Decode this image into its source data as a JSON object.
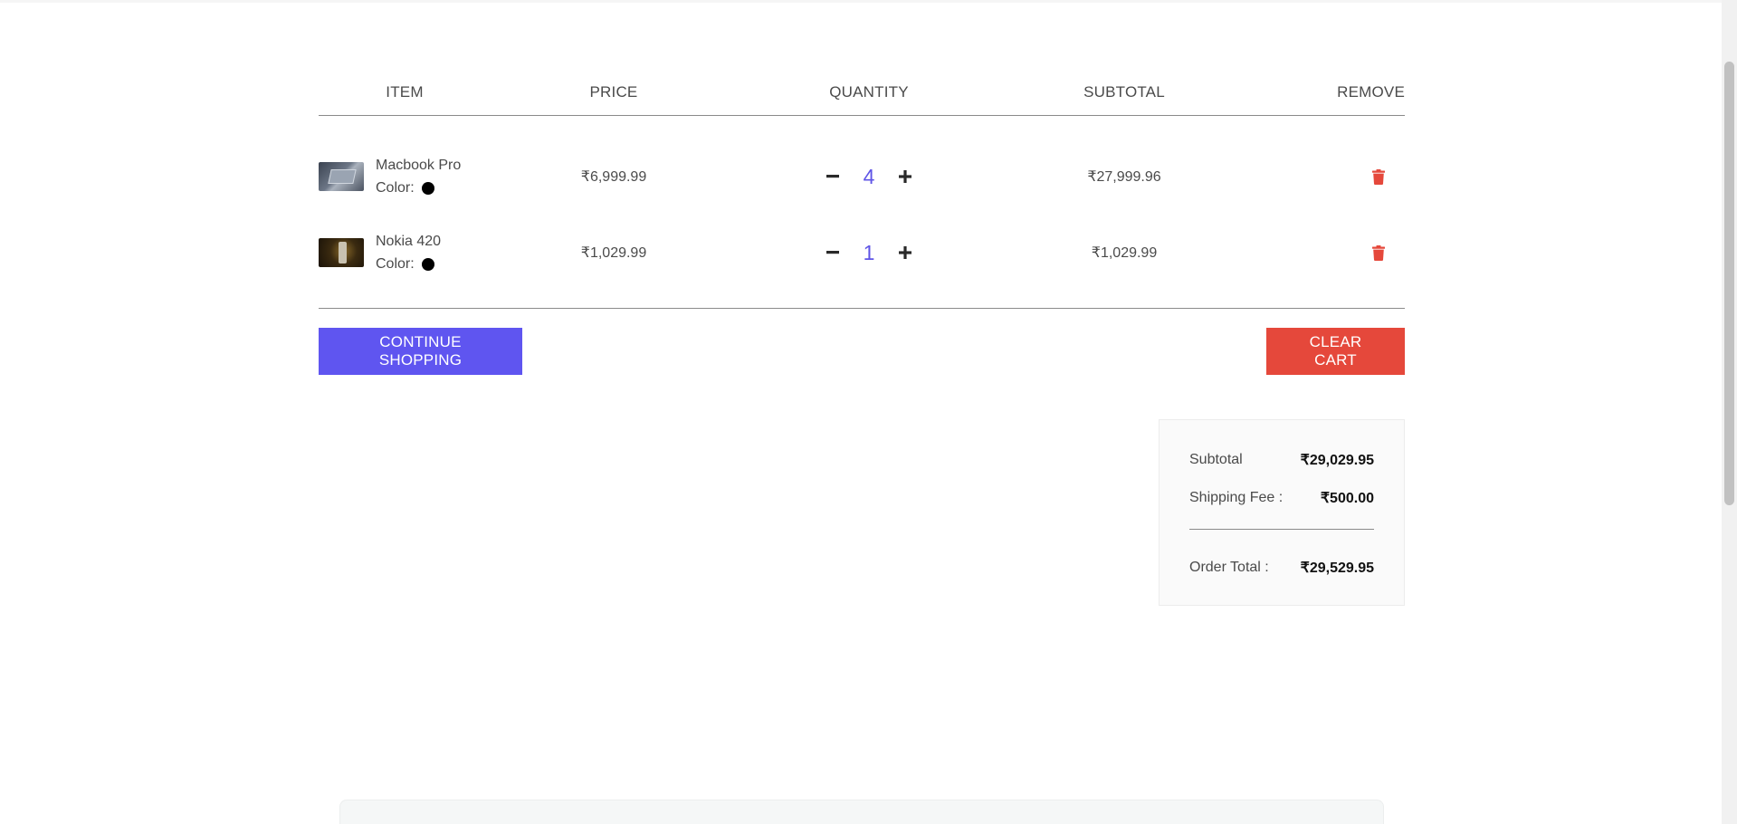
{
  "cart": {
    "headers": {
      "item": "ITEM",
      "price": "PRICE",
      "quantity": "QUANTITY",
      "subtotal": "SUBTOTAL",
      "remove": "REMOVE"
    },
    "color_label": "Color:",
    "items": [
      {
        "name": "Macbook Pro",
        "color": "#000000",
        "price": "₹6,999.99",
        "quantity": "4",
        "subtotal": "₹27,999.96",
        "image": "macbook-image"
      },
      {
        "name": "Nokia 420",
        "color": "#000000",
        "price": "₹1,029.99",
        "quantity": "1",
        "subtotal": "₹1,029.99",
        "image": "nokia-image"
      }
    ],
    "actions": {
      "continue_label": "CONTINUE SHOPPING",
      "clear_label": "CLEAR CART"
    }
  },
  "summary": {
    "subtotal_label": "Subtotal",
    "subtotal_value": "₹29,029.95",
    "shipping_label": "Shipping Fee :",
    "shipping_value": "₹500.00",
    "total_label": "Order Total :",
    "total_value": "₹29,529.95"
  },
  "icons": {
    "decrease": "minus-icon",
    "increase": "plus-icon",
    "remove": "trash-icon"
  },
  "colors": {
    "accent": "#5f55f0",
    "danger": "#e5483b",
    "quantity_text": "#5f55e6"
  }
}
